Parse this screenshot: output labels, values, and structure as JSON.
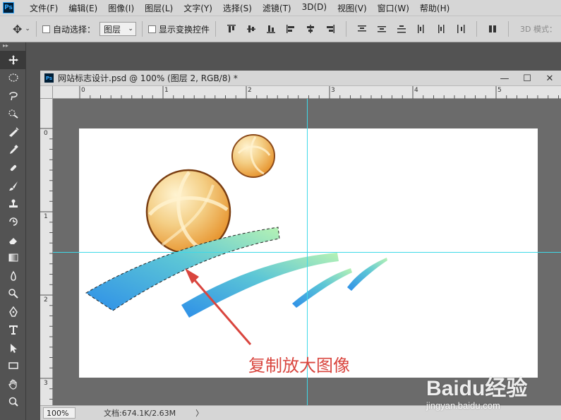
{
  "app": {
    "logo_text": "Ps"
  },
  "menu": {
    "items": [
      {
        "label": "文件(F)"
      },
      {
        "label": "编辑(E)"
      },
      {
        "label": "图像(I)"
      },
      {
        "label": "图层(L)"
      },
      {
        "label": "文字(Y)"
      },
      {
        "label": "选择(S)"
      },
      {
        "label": "滤镜(T)"
      },
      {
        "label": "3D(D)"
      },
      {
        "label": "视图(V)"
      },
      {
        "label": "窗口(W)"
      },
      {
        "label": "帮助(H)"
      }
    ]
  },
  "options": {
    "auto_select_label": "自动选择：",
    "auto_select_value": "图层",
    "show_transform_label": "显示变换控件",
    "mode_3d_label": "3D 模式："
  },
  "document": {
    "title": "网站标志设计.psd @ 100% (图层 2, RGB/8) *",
    "ruler_h_labels": [
      "0",
      "1",
      "2",
      "3",
      "4",
      "5"
    ],
    "ruler_v_labels": [
      "0",
      "1",
      "2",
      "3"
    ],
    "zoom": "100%",
    "doc_info": "文档:674.1K/2.63M",
    "status_arrow": "〉"
  },
  "annotation": {
    "text": "复制放大图像",
    "color": "#d9453e"
  },
  "watermark": {
    "logo": "Baidu经验",
    "url": "jingyan.baidu.com"
  },
  "colors": {
    "guide": "#3fd9e8",
    "canvas_bg": "#6b6b6b",
    "ui_bg": "#d6d6d6",
    "ball": "#e8a24a",
    "swoosh_blue": "#2e8fe8",
    "swoosh_green": "#a7eeb0"
  }
}
